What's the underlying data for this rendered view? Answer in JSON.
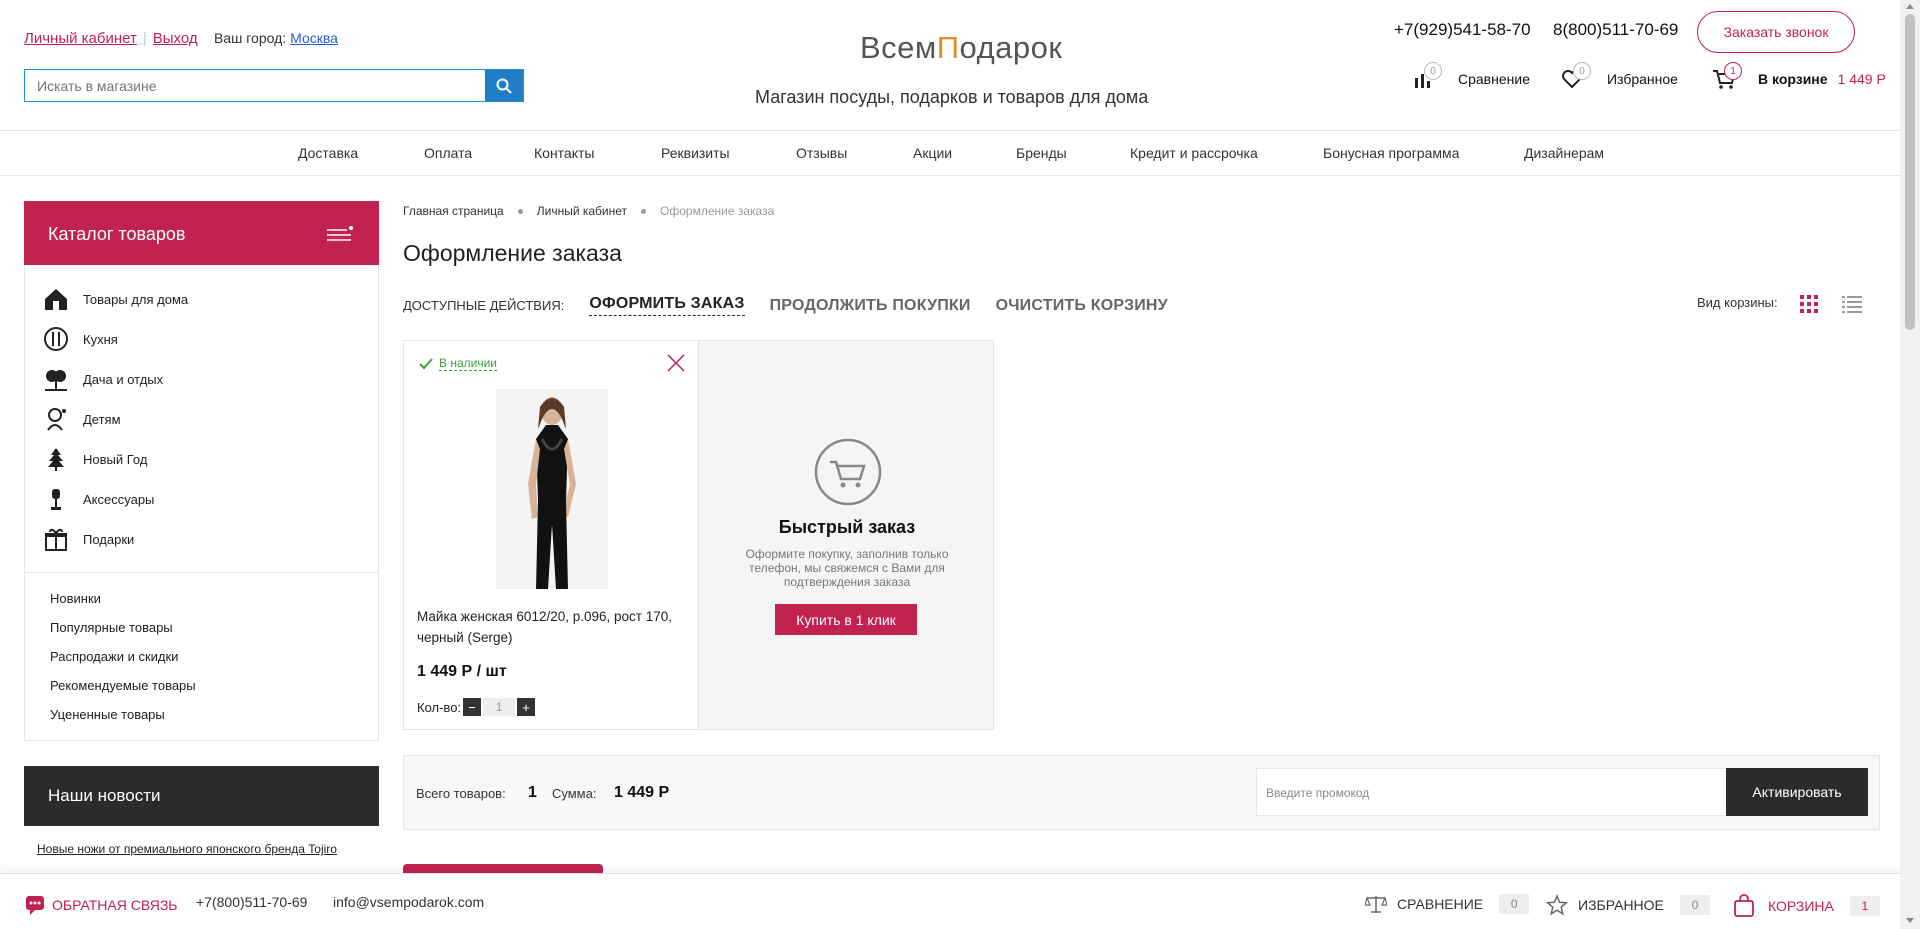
{
  "header": {
    "account_link": "Личный кабинет",
    "logout_link": "Выход",
    "city_label": "Ваш город:",
    "city_value": "Москва",
    "search_placeholder": "Искать в магазине",
    "logo_part1": "Всем",
    "logo_part2": "П",
    "logo_part3": "о",
    "logo_part4": "дарок",
    "tagline": "Магазин посуды, подарков и товаров для дома",
    "phone1": "+7(929)541-58-70",
    "phone2": "8(800)511-70-69",
    "callback_button": "Заказать звонок",
    "compare_label": "Сравнение",
    "compare_count": "0",
    "favorites_label": "Избранное",
    "favorites_count": "0",
    "cart_label": "В корзине",
    "cart_count": "1",
    "cart_sum": "1 449 Р",
    "accent_color": "#c1224f"
  },
  "nav": {
    "items": [
      "Доставка",
      "Оплата",
      "Контакты",
      "Реквизиты",
      "Отзывы",
      "Акции",
      "Бренды",
      "Кредит и рассрочка",
      "Бонусная программа",
      "Дизайнерам"
    ]
  },
  "sidebar": {
    "catalog_title": "Каталог товаров",
    "categories": [
      {
        "label": "Товары для дома",
        "icon": "house-icon"
      },
      {
        "label": "Кухня",
        "icon": "kitchen-icon"
      },
      {
        "label": "Дача и отдых",
        "icon": "tree-icon"
      },
      {
        "label": "Детям",
        "icon": "kids-icon"
      },
      {
        "label": "Новый Год",
        "icon": "christmas-tree-icon"
      },
      {
        "label": "Аксессуары",
        "icon": "accessory-icon"
      },
      {
        "label": "Подарки",
        "icon": "gift-icon"
      }
    ],
    "subitems": [
      "Новинки",
      "Популярные товары",
      "Распродажи и скидки",
      "Рекомендуемые товары",
      "Уцененные товары"
    ],
    "news_title": "Наши новости",
    "news_link": "Новые ножи от премиального японского бренда Tojiro"
  },
  "main": {
    "breadcrumbs": [
      "Главная страница",
      "Личный кабинет",
      "Оформление заказа"
    ],
    "page_title": "Оформление заказа",
    "actions_label": "ДОСТУПНЫЕ ДЕЙСТВИЯ:",
    "actions": [
      "ОФОРМИТЬ ЗАКАЗ",
      "ПРОДОЛЖИТЬ ПОКУПКИ",
      "ОЧИСТИТЬ КОРЗИНУ"
    ],
    "view_label": "Вид корзины:",
    "product": {
      "stock": "В наличии",
      "name": "Майка женская 6012/20, р.096, рост 170, черный (Serge)",
      "price": "1 449 Р / шт",
      "qty_label": "Кол-во:",
      "qty_value": "1",
      "minus": "−",
      "plus": "+"
    },
    "quick_order": {
      "title": "Быстрый заказ",
      "text": "Оформите покупку, заполнив только телефон, мы свяжемся с Вами для подтверждения заказа",
      "button": "Купить в 1 клик"
    },
    "totals": {
      "items_label": "Всего товаров:",
      "items_value": "1",
      "sum_label": "Сумма:",
      "sum_value": "1 449 Р",
      "promo_placeholder": "Введите промокод",
      "activate_button": "Активировать"
    }
  },
  "footer": {
    "feedback": "ОБРАТНАЯ СВЯЗЬ",
    "phone": "+7(800)511-70-69",
    "email": "info@vsempodarok.com",
    "compare": "СРАВНЕНИЕ",
    "compare_count": "0",
    "favorites": "ИЗБРАННОЕ",
    "favorites_count": "0",
    "cart": "КОРЗИНА",
    "cart_count": "1"
  }
}
